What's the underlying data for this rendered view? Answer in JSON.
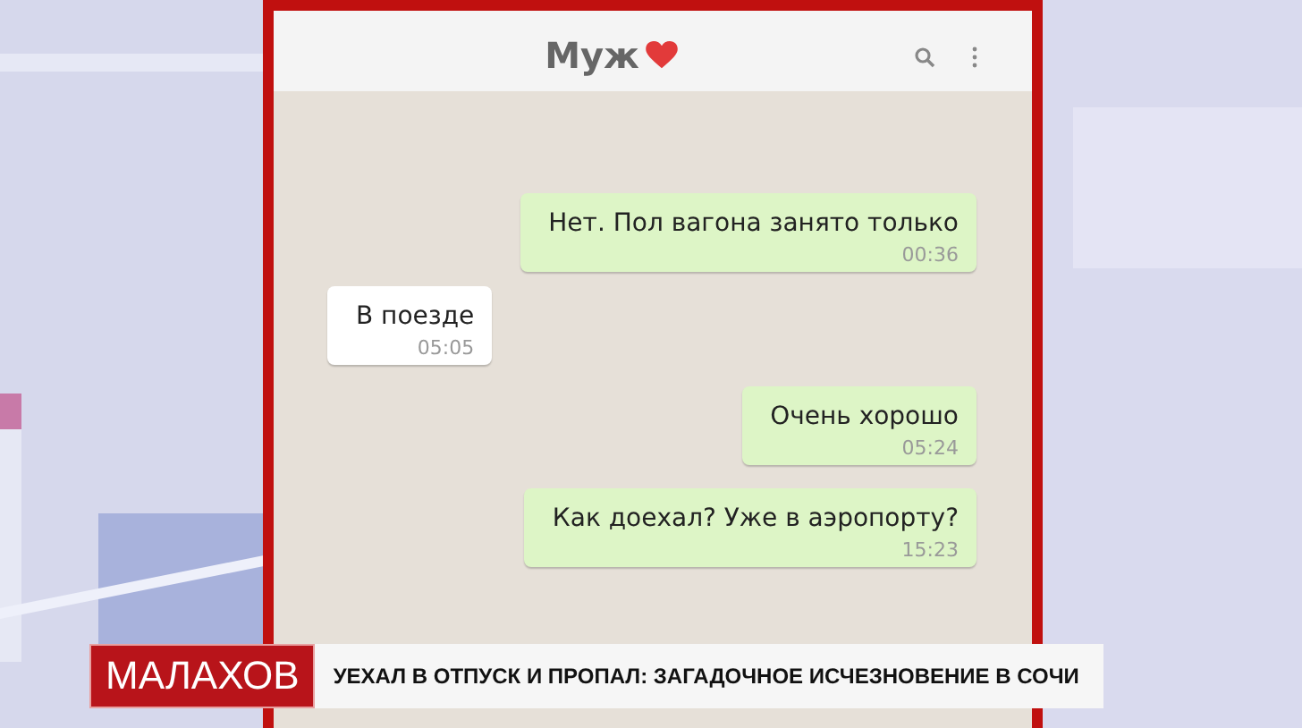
{
  "chat": {
    "title": "Муж",
    "messages": [
      {
        "kind": "outgoing",
        "text": "Нет. Пол вагона занято только",
        "time": "00:36"
      },
      {
        "kind": "incoming",
        "text": "В поезде",
        "time": "05:05"
      },
      {
        "kind": "outgoing",
        "text": "Очень хорошо",
        "time": "05:24"
      },
      {
        "kind": "outgoing",
        "text": "Как доехал? Уже в аэропорту?",
        "time": "15:23"
      }
    ]
  },
  "banner": {
    "show": "МАЛАХОВ",
    "headline": "УЕХАЛ В ОТПУСК И ПРОПАЛ: ЗАГАДОЧНОЕ ИСЧЕЗНОВЕНИЕ В СОЧИ"
  }
}
